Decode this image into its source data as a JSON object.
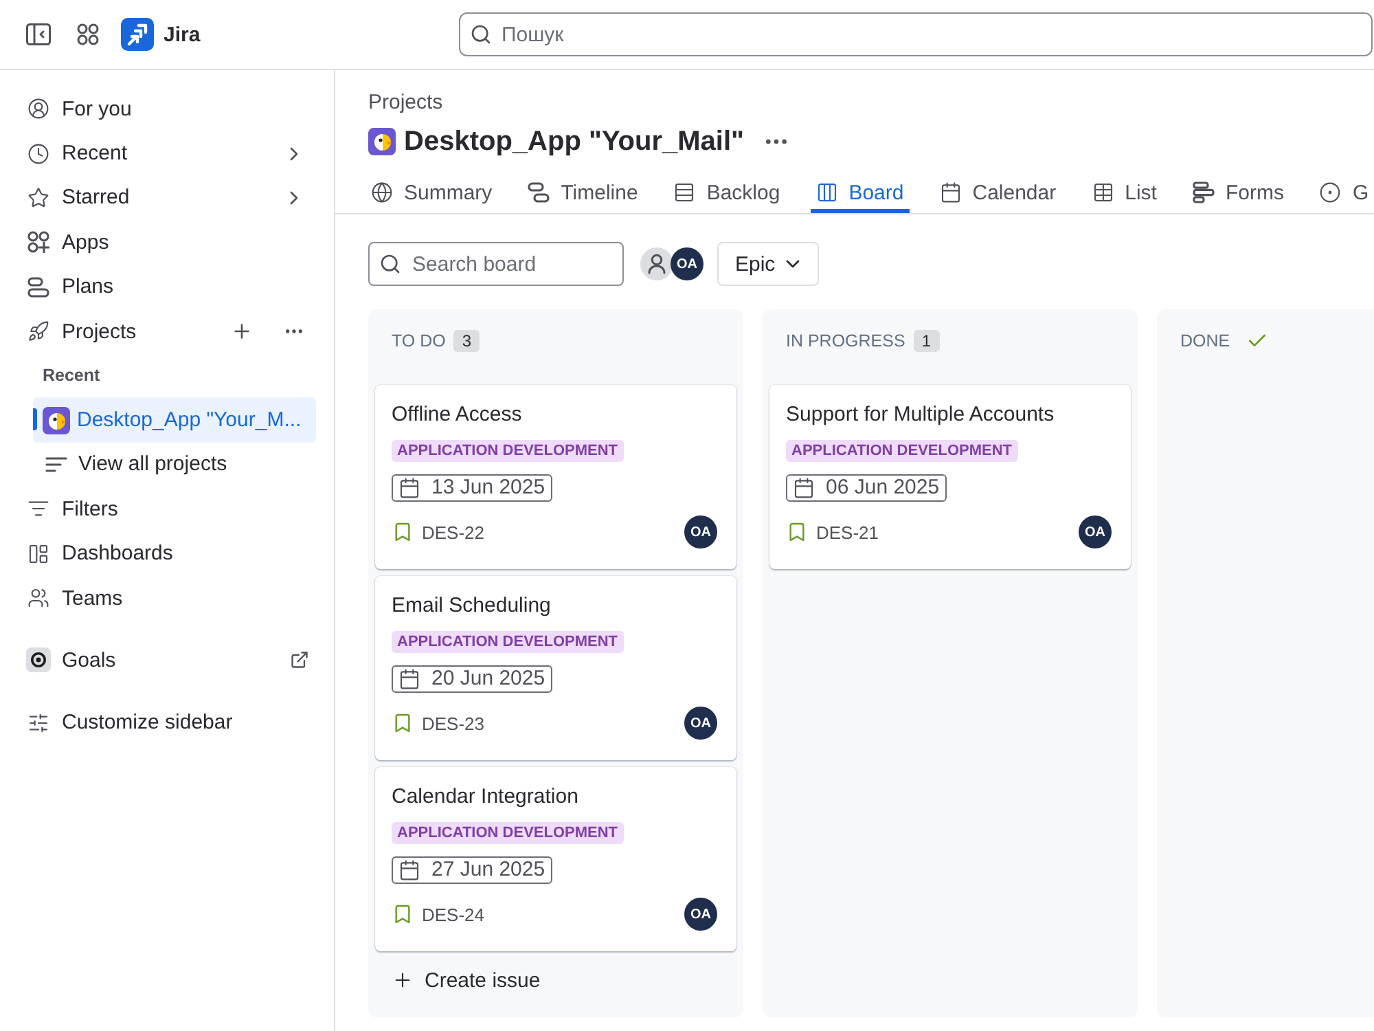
{
  "top_bar": {
    "product": "Jira",
    "search": {
      "placeholder": "Пошук"
    }
  },
  "sidebar": {
    "items": [
      {
        "kind": "nav",
        "label": "For you",
        "selected": false,
        "submenu": false
      },
      {
        "kind": "nav",
        "label": "Recent",
        "selected": false,
        "submenu": true
      },
      {
        "kind": "nav",
        "label": "Starred",
        "selected": false,
        "submenu": true
      },
      {
        "kind": "nav",
        "label": "Apps",
        "selected": false,
        "submenu": false
      },
      {
        "kind": "nav",
        "label": "Plans",
        "selected": false,
        "submenu": false
      },
      {
        "kind": "projects",
        "label": "Projects",
        "selected": false
      },
      {
        "kind": "heading",
        "label": "Recent"
      },
      {
        "kind": "project",
        "label": "Desktop_App \"Your_M...",
        "selected": true
      },
      {
        "kind": "sub",
        "label": "View all projects",
        "selected": false
      },
      {
        "kind": "nav",
        "label": "Filters",
        "selected": false,
        "submenu": false
      },
      {
        "kind": "nav",
        "label": "Dashboards",
        "selected": false,
        "submenu": false
      },
      {
        "kind": "nav",
        "label": "Teams",
        "selected": false,
        "submenu": false
      },
      {
        "kind": "external",
        "label": "Goals",
        "selected": false
      },
      {
        "kind": "customize",
        "label": "Customize sidebar",
        "selected": false
      }
    ]
  },
  "page": {
    "breadcrumb": "Projects",
    "title": "Desktop_App \"Your_Mail\""
  },
  "tabs": [
    {
      "label": "Summary",
      "selected": false
    },
    {
      "label": "Timeline",
      "selected": false
    },
    {
      "label": "Backlog",
      "selected": false
    },
    {
      "label": "Board",
      "selected": true
    },
    {
      "label": "Calendar",
      "selected": false
    },
    {
      "label": "List",
      "selected": false
    },
    {
      "label": "Forms",
      "selected": false
    },
    {
      "label": "G",
      "selected": false
    }
  ],
  "toolbar": {
    "search": {
      "placeholder": "Search board"
    },
    "people": [
      {
        "kind": "icon"
      },
      {
        "kind": "initials",
        "initials": "OA"
      }
    ],
    "filter": {
      "label": "Epic"
    }
  },
  "columns": [
    {
      "title": "TO DO",
      "count": "3",
      "done": false,
      "cards": [
        {
          "title": "Offline Access",
          "epic": "APPLICATION DEVELOPMENT",
          "due": "13 Jun 2025",
          "key": "DES-22",
          "assignee": "OA"
        },
        {
          "title": "Email Scheduling",
          "epic": "APPLICATION DEVELOPMENT",
          "due": "20 Jun 2025",
          "key": "DES-23",
          "assignee": "OA"
        },
        {
          "title": "Calendar Integration",
          "epic": "APPLICATION DEVELOPMENT",
          "due": "27 Jun 2025",
          "key": "DES-24",
          "assignee": "OA"
        }
      ],
      "create_label": "Create issue"
    },
    {
      "title": "IN PROGRESS",
      "count": "1",
      "done": false,
      "cards": [
        {
          "title": "Support for Multiple Accounts",
          "epic": "APPLICATION DEVELOPMENT",
          "due": "06 Jun 2025",
          "key": "DES-21",
          "assignee": "OA"
        }
      ]
    },
    {
      "title": "DONE",
      "done": true
    }
  ]
}
